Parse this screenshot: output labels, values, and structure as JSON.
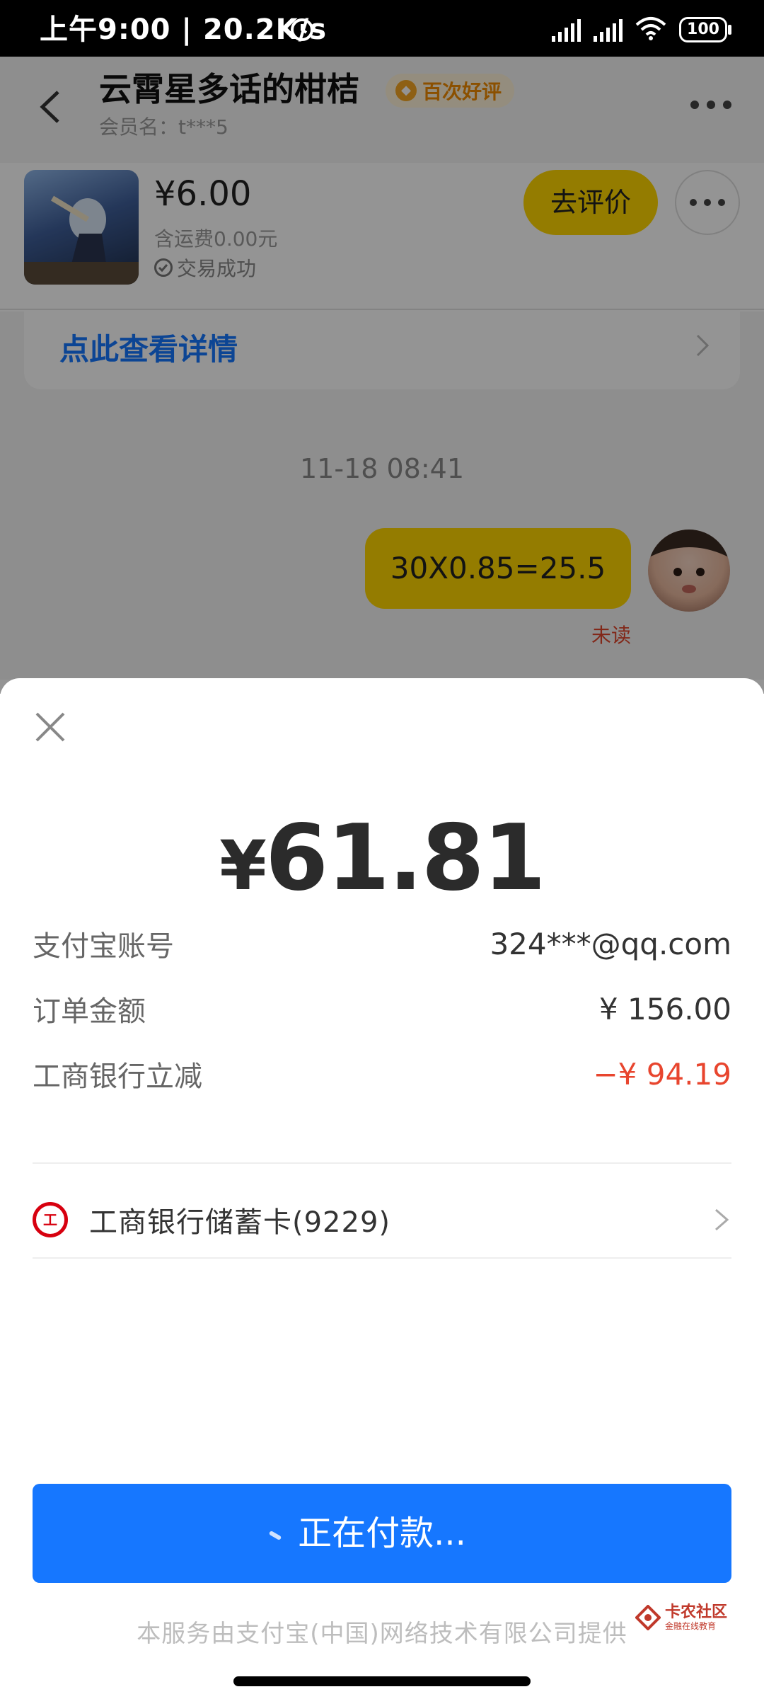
{
  "status_bar": {
    "time_speed": "上午9:00 | 20.2K/s",
    "battery": "100"
  },
  "chat": {
    "shop_name": "云霄星多话的柑桔",
    "badge": "百次好评",
    "member": "会员名：t***5",
    "order": {
      "price": "¥6.00",
      "shipping": "含运费0.00元",
      "status": "交易成功",
      "review_button": "去评价"
    },
    "detail_link": "点此查看详情",
    "timestamp": "11-18 08:41",
    "message": "30X0.85=25.5",
    "unread": "未读"
  },
  "payment": {
    "currency": "¥",
    "amount": "61.81",
    "rows": [
      {
        "label": "支付宝账号",
        "value": "324***@qq.com"
      },
      {
        "label": "订单金额",
        "value": "¥ 156.00"
      },
      {
        "label": "工商银行立减",
        "value": "−¥ 94.19"
      }
    ],
    "bank_icon": "icbc-icon",
    "bank_name": "工商银行储蓄卡(9229)",
    "pay_button": "正在付款...",
    "footer": "本服务由支付宝(中国)网络技术有限公司提供"
  },
  "watermark": {
    "title": "卡农社区",
    "subtitle": "金融在线教育"
  },
  "colors": {
    "accent_blue": "#1677ff",
    "accent_yellow": "#ffd600",
    "discount_red": "#e8452e"
  }
}
